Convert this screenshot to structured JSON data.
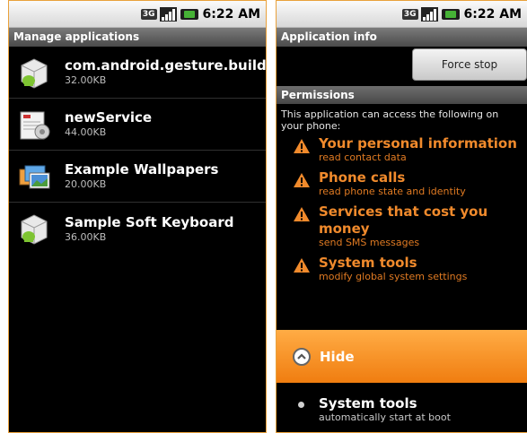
{
  "status": {
    "network": "3G",
    "time": "6:22 AM"
  },
  "left": {
    "title": "Manage applications",
    "apps": [
      {
        "name": "com.android.gesture.builder",
        "size": "32.00KB",
        "icon": "android-package-icon"
      },
      {
        "name": "newService",
        "size": "44.00KB",
        "icon": "service-app-icon"
      },
      {
        "name": "Example Wallpapers",
        "size": "20.00KB",
        "icon": "wallpapers-app-icon"
      },
      {
        "name": "Sample Soft Keyboard",
        "size": "36.00KB",
        "icon": "android-package-icon"
      }
    ]
  },
  "right": {
    "title": "Application info",
    "force_stop_label": "Force stop",
    "permissions_header": "Permissions",
    "permissions_intro": "This application can access the following on your phone:",
    "permissions": [
      {
        "title": "Your personal information",
        "desc": "read contact data"
      },
      {
        "title": "Phone calls",
        "desc": "read phone state and identity"
      },
      {
        "title": "Services that cost you money",
        "desc": "send SMS messages"
      },
      {
        "title": "System tools",
        "desc": "modify global system settings"
      }
    ],
    "hide_label": "Hide",
    "hidden_permission": {
      "title": "System tools",
      "desc": "automatically start at boot"
    }
  },
  "colors": {
    "accent_orange": "#f08a2c",
    "hide_bar": "#f58a1f",
    "border": "#e9a13b"
  }
}
